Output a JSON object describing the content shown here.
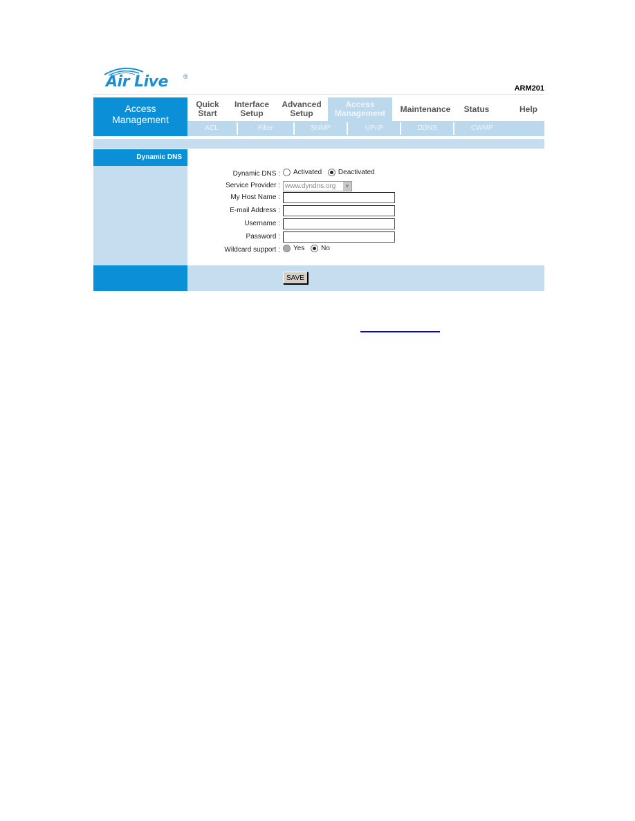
{
  "header": {
    "logo_text": "Air Live",
    "logo_reg": "®",
    "model": "ARM201"
  },
  "nav": {
    "brand_line1": "Access",
    "brand_line2": "Management",
    "tabs": [
      {
        "line1": "Quick",
        "line2": "Start",
        "active": false
      },
      {
        "line1": "Interface",
        "line2": "Setup",
        "active": false
      },
      {
        "line1": "Advanced",
        "line2": "Setup",
        "active": false
      },
      {
        "line1": "Access",
        "line2": "Management",
        "active": true
      },
      {
        "line1": "Maintenance",
        "line2": "",
        "active": false
      },
      {
        "line1": "Status",
        "line2": "",
        "active": false
      },
      {
        "line1": "Help",
        "line2": "",
        "active": false
      }
    ],
    "subtabs": [
      "ACL",
      "Filter",
      "SNMP",
      "UPnP",
      "DDNS",
      "CWMP"
    ]
  },
  "section": {
    "title": "Dynamic DNS"
  },
  "form": {
    "dynamic_dns": {
      "label": "Dynamic DNS :",
      "options": [
        "Activated",
        "Deactivated"
      ],
      "selected": "Deactivated"
    },
    "service_provider": {
      "label": "Service Provider :",
      "value": "www.dyndns.org"
    },
    "host_name": {
      "label": "My Host Name :",
      "value": ""
    },
    "email": {
      "label": "E-mail Address :",
      "value": ""
    },
    "username": {
      "label": "Username :",
      "value": ""
    },
    "password": {
      "label": "Password :",
      "value": ""
    },
    "wildcard": {
      "label": "Wildcard support :",
      "options": [
        "Yes",
        "No"
      ],
      "selected": "No"
    }
  },
  "actions": {
    "save_label": "SAVE"
  },
  "colors": {
    "brand_blue": "#0b8fd6",
    "light_blue": "#c6ddef",
    "link_blue": "#0000ee"
  }
}
